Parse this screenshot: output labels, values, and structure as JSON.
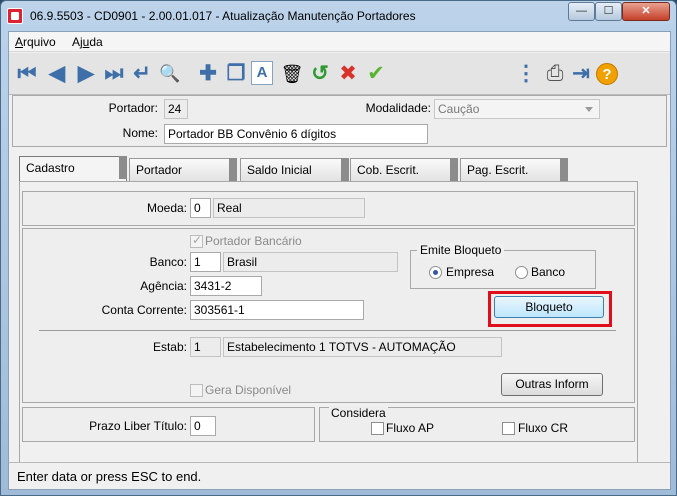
{
  "window": {
    "title": "06.9.5503 - CD0901 - 2.00.01.017 - Atualização Manutenção Portadores",
    "min": "—",
    "max": "☐",
    "close": "✕"
  },
  "menu": {
    "arquivo": "Arquivo",
    "arquivo_key": "A",
    "arquivo_rest": "rquivo",
    "ajuda_pre": "Aj",
    "ajuda_key": "u",
    "ajuda_rest": "da"
  },
  "toolbar": {
    "first_icon": "⏮",
    "prev_icon": "◀",
    "next_icon": "▶",
    "last_icon": "⏭",
    "goto_icon": "↵",
    "search_icon": "🔍",
    "add_icon": "✚",
    "copy_icon": "❐",
    "edit_icon": "A",
    "delete_icon": "🗑",
    "undo_icon": "↺",
    "cancel_icon": "✖",
    "ok_icon": "✔",
    "tree_icon": "⋮",
    "print_icon": "⎙",
    "exit_icon": "⇥",
    "help_icon": "?"
  },
  "header": {
    "portador_label": "Portador:",
    "portador_value": "24",
    "modalidade_label": "Modalidade:",
    "modalidade_value": "Caução",
    "nome_label": "Nome:",
    "nome_value": "Portador BB Convênio 6 dígitos"
  },
  "tabs": [
    "Cadastro",
    "Portador",
    "Saldo Inicial",
    "Cob. Escrit.",
    "Pag. Escrit."
  ],
  "cadastro": {
    "moeda_label": "Moeda:",
    "moeda_code": "0",
    "moeda_name": "Real",
    "portador_bancario": "Portador Bancário",
    "banco_label": "Banco:",
    "banco_code": "1",
    "banco_name": "Brasil",
    "agencia_label": "Agência:",
    "agencia_value": "3431-2",
    "conta_label": "Conta Corrente:",
    "conta_value": "303561-1",
    "emite_bloqueto": "Emite Bloqueto",
    "radio_empresa": "Empresa",
    "radio_banco": "Banco",
    "bloqueto_button": "Bloqueto",
    "estab_label": "Estab:",
    "estab_code": "1",
    "estab_name": "Estabelecimento 1 TOTVS - AUTOMAÇÃO",
    "gera_disponivel": "Gera Disponível",
    "outras_inform_button": "Outras Inform",
    "prazo_label": "Prazo Liber Título:",
    "prazo_value": "0",
    "considera": "Considera",
    "fluxo_ap": "Fluxo AP",
    "fluxo_cr": "Fluxo CR"
  },
  "status": "Enter data or press ESC to end.",
  "colors": {
    "highlight": "#e00d1a",
    "undo": "#2f9a2f",
    "cancel": "#d8332a",
    "ok": "#58b530",
    "help": "#f0a000"
  }
}
